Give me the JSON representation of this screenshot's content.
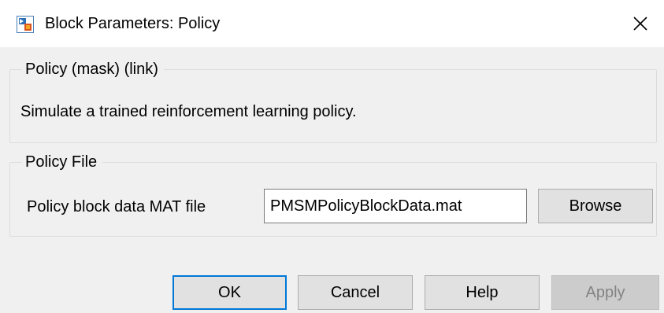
{
  "window": {
    "title": "Block Parameters: Policy",
    "icon": "simulink-block-icon",
    "close_icon": "close-icon"
  },
  "mask_group": {
    "legend": "Policy (mask) (link)",
    "description": "Simulate a trained reinforcement learning policy."
  },
  "file_group": {
    "legend": "Policy File",
    "param_label": "Policy block data MAT file",
    "param_value": "PMSMPolicyBlockData.mat",
    "browse_label": "Browse"
  },
  "footer": {
    "ok_label": "OK",
    "cancel_label": "Cancel",
    "help_label": "Help",
    "apply_label": "Apply",
    "apply_enabled": false
  },
  "colors": {
    "focus_border": "#0078d7",
    "disabled_text": "#838383"
  }
}
